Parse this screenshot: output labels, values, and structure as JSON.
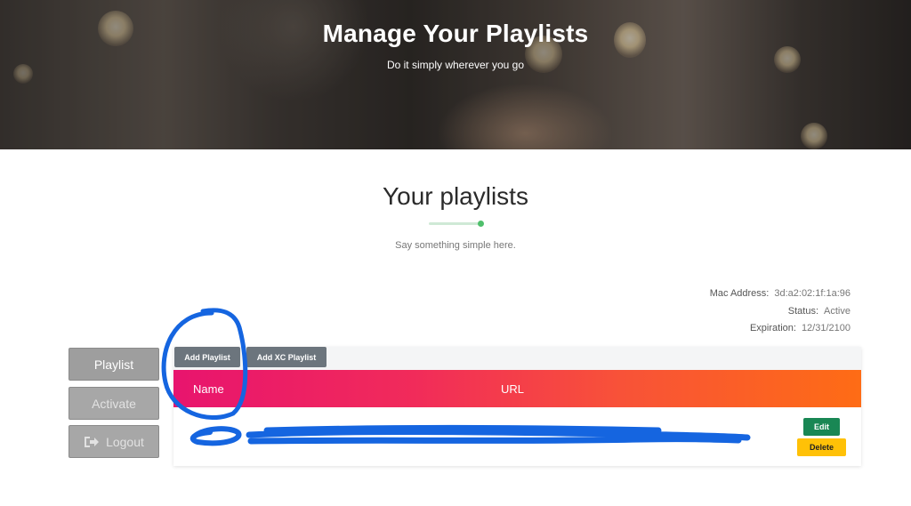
{
  "hero": {
    "title": "Manage Your Playlists",
    "subtitle": "Do it simply wherever you go"
  },
  "section": {
    "title": "Your playlists",
    "subtitle": "Say something simple here."
  },
  "device_info": {
    "mac_label": "Mac Address:",
    "mac_value": "3d:a2:02:1f:1a:96",
    "status_label": "Status:",
    "status_value": "Active",
    "expiration_label": "Expiration:",
    "expiration_value": "12/31/2100"
  },
  "sidebar": {
    "items": [
      {
        "label": "Playlist",
        "active": true
      },
      {
        "label": "Activate",
        "active": false
      },
      {
        "label": "Logout",
        "active": false,
        "icon": "logout-icon"
      }
    ]
  },
  "toolbar": {
    "add_playlist_label": "Add Playlist",
    "add_xc_playlist_label": "Add XC Playlist"
  },
  "table": {
    "columns": [
      "Name",
      "URL"
    ],
    "rows": [
      {
        "name": "",
        "url": "",
        "actions": {
          "edit_label": "Edit",
          "delete_label": "Delete"
        }
      }
    ]
  },
  "colors": {
    "header_gradient_start": "#e8146e",
    "header_gradient_end": "#fe6c15",
    "edit_button": "#198754",
    "delete_button": "#ffc107",
    "toolbar_button": "#6c757d",
    "annotation_ink": "#1565e0",
    "divider_dot": "#4fbf6b"
  }
}
